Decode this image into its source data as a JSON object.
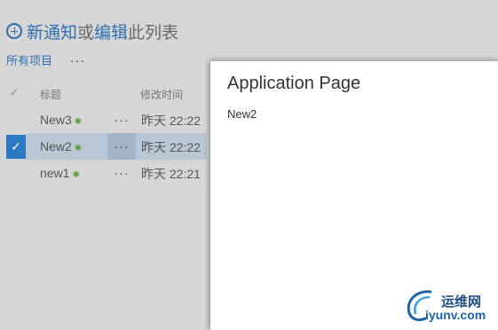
{
  "command_bar": {
    "new_item_prefix": "新通知",
    "or_text": "或",
    "edit_text": "编辑",
    "this_list_text": "此列表"
  },
  "view": {
    "selector_label": "所有项目",
    "more_label": "···"
  },
  "list": {
    "columns": {
      "check_glyph": "✓",
      "title": "标题",
      "modified": "修改时间"
    },
    "rows": [
      {
        "title": "New3",
        "badge": "✱",
        "menu": "···",
        "modified": "昨天 22:22",
        "selected": false
      },
      {
        "title": "New2",
        "badge": "✱",
        "menu": "···",
        "modified": "昨天 22:22",
        "selected": true,
        "check": "✓"
      },
      {
        "title": "new1",
        "badge": "✱",
        "menu": "···",
        "modified": "昨天 22:21",
        "selected": false
      }
    ]
  },
  "dialog": {
    "title": "Application Page",
    "body_text": "New2"
  },
  "watermark": {
    "cn_text": "运维网",
    "en_text": "iyunv.com"
  },
  "colors": {
    "accent": "#2f6fad",
    "selected_row": "#b9c6d3",
    "selected_check": "#2b79c2",
    "background": "#d6d6d6",
    "new_badge": "#5a9e3a"
  }
}
